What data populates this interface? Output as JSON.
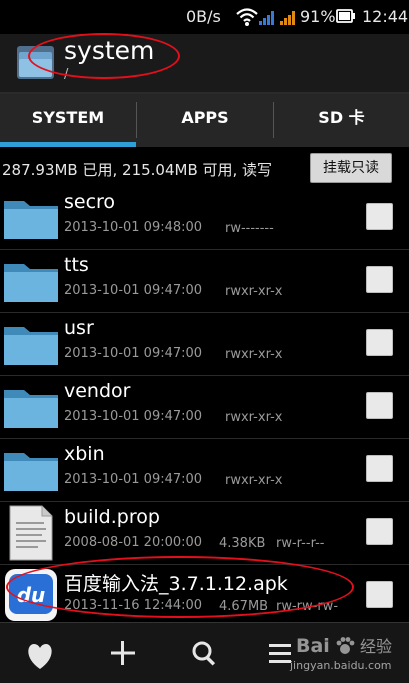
{
  "status_bar": {
    "network_speed": "0B/s",
    "battery": "91%",
    "time": "12:44"
  },
  "title_bar": {
    "title": "system",
    "path": "/"
  },
  "tabs": [
    {
      "label": "SYSTEM"
    },
    {
      "label": "APPS"
    },
    {
      "label": "SD 卡"
    }
  ],
  "storage": {
    "summary": "287.93MB 已用, 215.04MB 可用, 读写",
    "mount_button": "挂载只读"
  },
  "files": [
    {
      "name": "secro",
      "date": "2013-10-01 09:48:00",
      "size": "",
      "perms": "rw-------",
      "icon": "folder-icon"
    },
    {
      "name": "tts",
      "date": "2013-10-01 09:47:00",
      "size": "",
      "perms": "rwxr-xr-x",
      "icon": "folder-icon"
    },
    {
      "name": "usr",
      "date": "2013-10-01 09:47:00",
      "size": "",
      "perms": "rwxr-xr-x",
      "icon": "folder-icon"
    },
    {
      "name": "vendor",
      "date": "2013-10-01 09:47:00",
      "size": "",
      "perms": "rwxr-xr-x",
      "icon": "folder-icon"
    },
    {
      "name": "xbin",
      "date": "2013-10-01 09:47:00",
      "size": "",
      "perms": "rwxr-xr-x",
      "icon": "folder-icon"
    },
    {
      "name": "build.prop",
      "date": "2008-08-01 20:00:00",
      "size": "4.38KB",
      "perms": "rw-r--r--",
      "icon": "document-icon"
    },
    {
      "name": "百度输入法_3.7.1.12.apk",
      "date": "2013-11-16 12:44:00",
      "size": "4.67MB",
      "perms": "rw-rw-rw-",
      "icon": "du-app-icon"
    }
  ],
  "bottom_bar": {
    "icons": [
      "heart-icon",
      "plus-icon",
      "search-icon",
      "menu-icon"
    ]
  },
  "watermark": {
    "brand": "Bai",
    "brand2": "经验",
    "url": "jingyan.baidu.com"
  },
  "colors": {
    "accent": "#2e9fd7",
    "annotation": "#e3101c",
    "folder": "#5aa9d6"
  }
}
